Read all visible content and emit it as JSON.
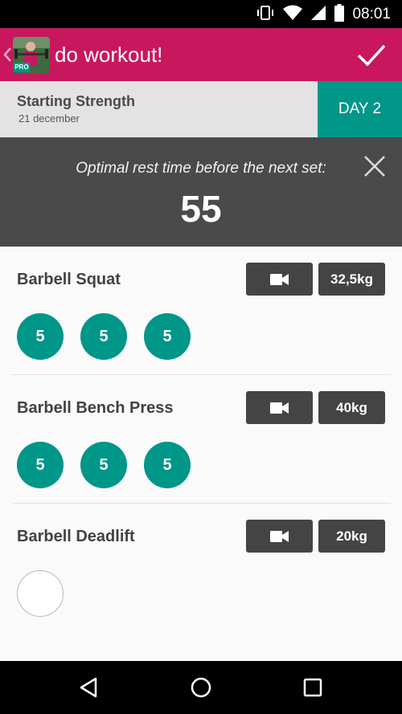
{
  "status_bar": {
    "time": "08:01",
    "icons": [
      "vibrate-icon",
      "wifi-icon",
      "signal-icon",
      "battery-icon"
    ]
  },
  "app_bar": {
    "title": "do workout!",
    "logo_badge": "PRO",
    "icons": [
      "back-chevron-icon",
      "checkmark-icon"
    ]
  },
  "program": {
    "name": "Starting Strength",
    "date": "21 december",
    "day": "DAY 2"
  },
  "rest": {
    "label": "Optimal rest time before the next set:",
    "seconds": "55"
  },
  "exercises": [
    {
      "name": "Barbell Squat",
      "weight": "32,5kg",
      "sets": [
        "5",
        "5",
        "5"
      ]
    },
    {
      "name": "Barbell Bench Press",
      "weight": "40kg",
      "sets": [
        "5",
        "5",
        "5"
      ]
    },
    {
      "name": "Barbell Deadlift",
      "weight": "20kg",
      "sets": [
        ""
      ]
    }
  ],
  "colors": {
    "accent": "#c8175d",
    "teal": "#009688",
    "dark_panel": "#4a4a4a",
    "button_dark": "#444444"
  }
}
